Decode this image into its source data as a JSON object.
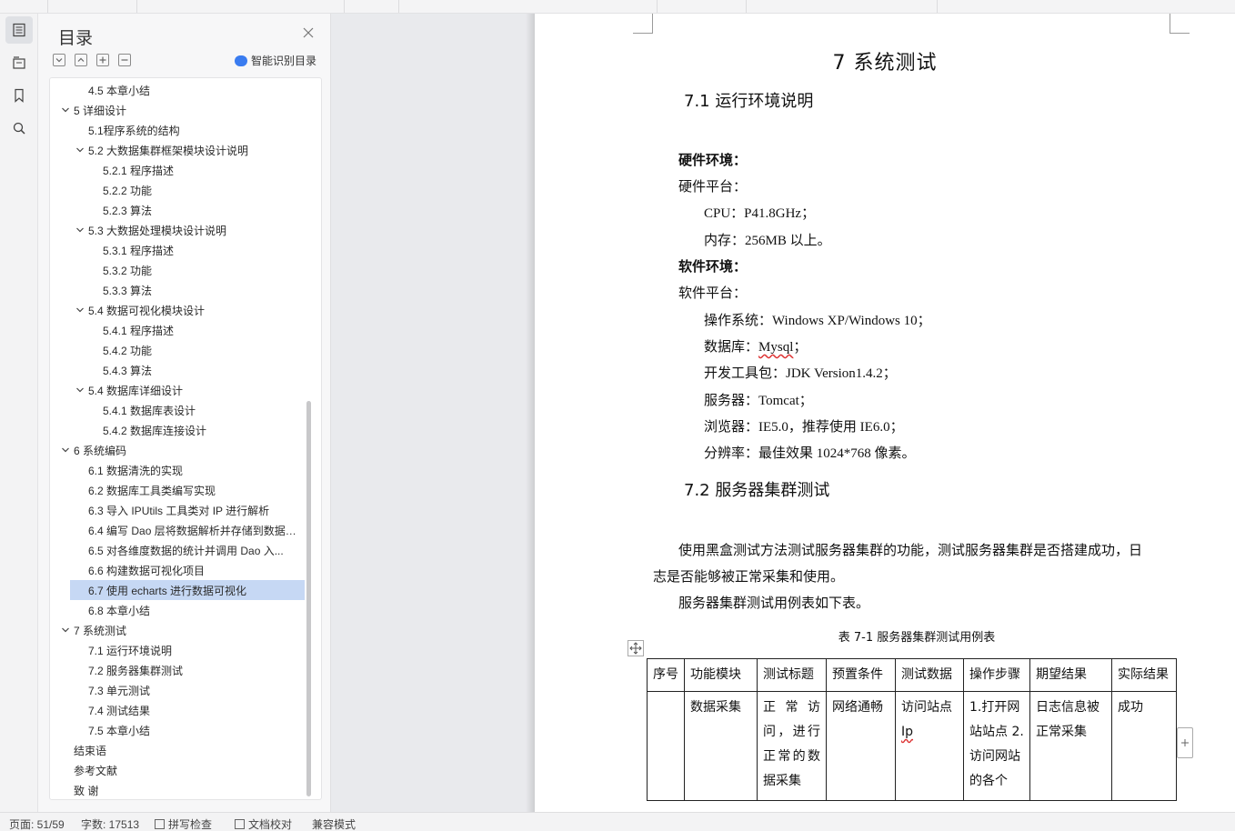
{
  "toc_panel": {
    "title": "目录",
    "smart_button": "智能识别目录",
    "items": [
      {
        "label": "4.5  本章小结",
        "level": 2,
        "expanded": null,
        "selected": false
      },
      {
        "label": "5    详细设计",
        "level": 1,
        "expanded": true,
        "selected": false
      },
      {
        "label": "5.1程序系统的结构",
        "level": 2,
        "expanded": null,
        "selected": false
      },
      {
        "label": "5.2    大数据集群框架模块设计说明",
        "level": 2,
        "expanded": true,
        "selected": false
      },
      {
        "label": "5.2.1  程序描述",
        "level": 3,
        "expanded": null,
        "selected": false
      },
      {
        "label": "5.2.2  功能",
        "level": 3,
        "expanded": null,
        "selected": false
      },
      {
        "label": "5.2.3  算法",
        "level": 3,
        "expanded": null,
        "selected": false
      },
      {
        "label": "5.3    大数据处理模块设计说明",
        "level": 2,
        "expanded": true,
        "selected": false
      },
      {
        "label": "5.3.1  程序描述",
        "level": 3,
        "expanded": null,
        "selected": false
      },
      {
        "label": "5.3.2  功能",
        "level": 3,
        "expanded": null,
        "selected": false
      },
      {
        "label": "5.3.3  算法",
        "level": 3,
        "expanded": null,
        "selected": false
      },
      {
        "label": "5.4    数据可视化模块设计",
        "level": 2,
        "expanded": true,
        "selected": false
      },
      {
        "label": "5.4.1  程序描述",
        "level": 3,
        "expanded": null,
        "selected": false
      },
      {
        "label": "5.4.2  功能",
        "level": 3,
        "expanded": null,
        "selected": false
      },
      {
        "label": "5.4.3  算法",
        "level": 3,
        "expanded": null,
        "selected": false
      },
      {
        "label": "5.4    数据库详细设计",
        "level": 2,
        "expanded": true,
        "selected": false
      },
      {
        "label": "5.4.1  数据库表设计",
        "level": 3,
        "expanded": null,
        "selected": false
      },
      {
        "label": "5.4.2  数据库连接设计",
        "level": 3,
        "expanded": null,
        "selected": false
      },
      {
        "label": "6    系统编码",
        "level": 1,
        "expanded": true,
        "selected": false
      },
      {
        "label": "6.1  数据清洗的实现",
        "level": 2,
        "expanded": null,
        "selected": false
      },
      {
        "label": "6.2  数据库工具类编写实现",
        "level": 2,
        "expanded": null,
        "selected": false
      },
      {
        "label": "6.3 导入 IPUtils 工具类对 IP 进行解析",
        "level": 2,
        "expanded": null,
        "selected": false
      },
      {
        "label": "6.4 编写 Dao 层将数据解析并存储到数据库...",
        "level": 2,
        "expanded": null,
        "selected": false
      },
      {
        "label": "6.5  对各维度数据的统计并调用 Dao 入...",
        "level": 2,
        "expanded": null,
        "selected": false
      },
      {
        "label": "6.6  构建数据可视化项目",
        "level": 2,
        "expanded": null,
        "selected": false
      },
      {
        "label": "6.7  使用 echarts 进行数据可视化",
        "level": 2,
        "expanded": null,
        "selected": true
      },
      {
        "label": "6.8  本章小结",
        "level": 2,
        "expanded": null,
        "selected": false
      },
      {
        "label": "7    系统测试",
        "level": 1,
        "expanded": true,
        "selected": false
      },
      {
        "label": "7.1  运行环境说明",
        "level": 2,
        "expanded": null,
        "selected": false
      },
      {
        "label": "7.2  服务器集群测试",
        "level": 2,
        "expanded": null,
        "selected": false
      },
      {
        "label": "7.3  单元测试",
        "level": 2,
        "expanded": null,
        "selected": false
      },
      {
        "label": "7.4  测试结果",
        "level": 2,
        "expanded": null,
        "selected": false
      },
      {
        "label": "7.5  本章小结",
        "level": 2,
        "expanded": null,
        "selected": false
      },
      {
        "label": "结束语",
        "level": 1,
        "expanded": null,
        "selected": false
      },
      {
        "label": "参考文献",
        "level": 1,
        "expanded": null,
        "selected": false
      },
      {
        "label": "致    谢",
        "level": 1,
        "expanded": null,
        "selected": false
      }
    ]
  },
  "document": {
    "chapter_title": "7    系统测试",
    "section1_title": "7.1  运行环境说明",
    "hardware_heading": "硬件环境：",
    "hardware_platform": "硬件平台：",
    "cpu": "CPU：P41.8GHz；",
    "memory": "内存：256MB 以上。",
    "software_heading": "软件环境：",
    "software_platform": "软件平台：",
    "os": "操作系统：Windows XP/Windows 10；",
    "db_prefix": "数据库：",
    "db_value": "Mysql",
    "db_suffix": "；",
    "jdk": "开发工具包：JDK Version1.4.2；",
    "server": "服务器：Tomcat；",
    "browser": "浏览器：IE5.0，推荐使用 IE6.0；",
    "resolution": "分辨率：最佳效果 1024*768 像素。",
    "section2_title": "7.2  服务器集群测试",
    "para1_line1": "使用黑盒测试方法测试服务器集群的功能，测试服务器集群是否搭建成功，日",
    "para1_line2": "志是否能够被正常采集和使用。",
    "para2": "服务器集群测试用例表如下表。",
    "table_caption": "表 7-1 服务器集群测试用例表",
    "table": {
      "headers": [
        "序号",
        "功能模块",
        "测试标题",
        "预置条件",
        "测试数据",
        "操作步骤",
        "期望结果",
        "实际结果"
      ],
      "row1": {
        "index": "",
        "module": "数据采集",
        "title": "正常访问，进行正常的数据采集",
        "precondition": "网络通畅",
        "data_prefix": "访问站点",
        "data_value": "Ip",
        "steps": "1.打开网站站点 2.访问网站的各个",
        "expected": "日志信息被正常采集",
        "actual": "成功"
      }
    }
  },
  "status_bar": {
    "page": "页面: 51/59",
    "words": "字数: 17513",
    "spell": "拼写检查",
    "proof": "文档校对",
    "compat": "兼容模式"
  }
}
